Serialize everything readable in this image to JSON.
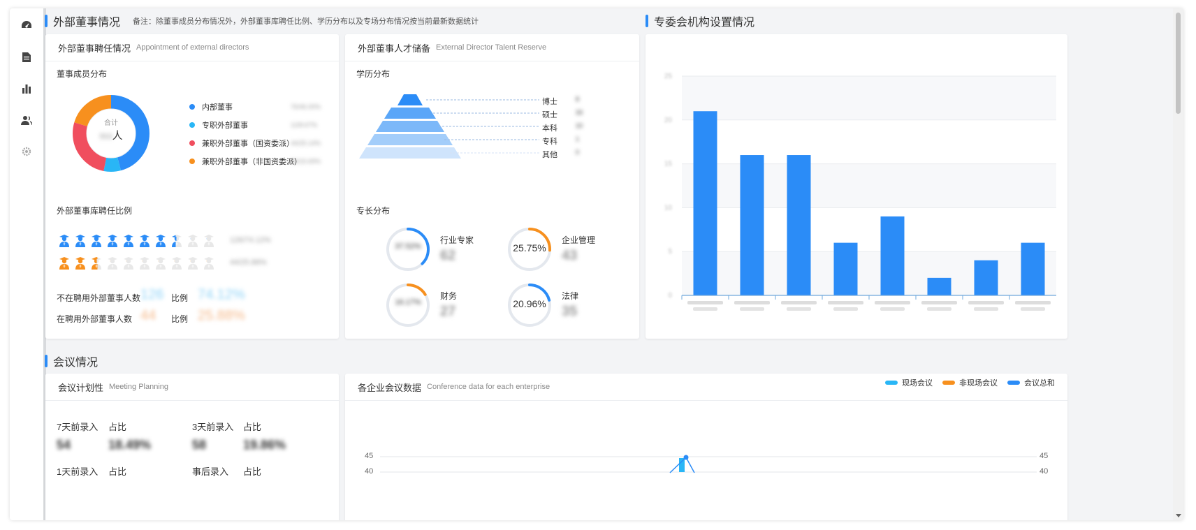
{
  "sidebar": {
    "icons": [
      "dashboard-icon",
      "document-icon",
      "bar-chart-icon",
      "users-icon",
      "gear-icon"
    ]
  },
  "sections": {
    "external_directors": {
      "title": "外部董事情况",
      "note": "备注：除董事成员分布情况外，外部董事库聘任比例、学历分布以及专场分布情况按当前最新数据统计"
    },
    "committee": {
      "title": "专委会机构设置情况"
    },
    "meetings": {
      "title": "会议情况"
    }
  },
  "appointment_card": {
    "title": "外部董事聘任情况",
    "title_en": "Appointment of external directors",
    "member_dist_label": "董事成员分布",
    "donut": {
      "center_label": "合计",
      "center_value": "553",
      "center_unit": "人"
    },
    "legend": [
      {
        "label": "内部董事",
        "value": "76/46.00%",
        "color": "#2b8cf7"
      },
      {
        "label": "专职外部董事",
        "value": "12/8.67%",
        "color": "#29b6f6"
      },
      {
        "label": "兼职外部董事（国资委派）",
        "value": "44/25.14%",
        "color": "#f04e5e"
      },
      {
        "label": "兼职外部董事（非国资委派）",
        "value": "34/15.69%",
        "color": "#f7901e"
      }
    ],
    "ratio_label": "外部董事库聘任比例",
    "people_rows": [
      {
        "value": "126/74.12%",
        "fill": 0.74,
        "color": "#2b8cf7"
      },
      {
        "value": "44/25.88%",
        "fill": 0.26,
        "color": "#f7901e"
      }
    ],
    "stats": [
      {
        "label": "不在聘用外部董事人数",
        "num": "126",
        "ratio_label": "比例",
        "pct": "74.12%",
        "color": "#8fd3f7"
      },
      {
        "label": "在聘用外部董事人数",
        "num": "44",
        "ratio_label": "比例",
        "pct": "25.88%",
        "color": "#f5b98a"
      }
    ]
  },
  "talent_card": {
    "title": "外部董事人才储备",
    "title_en": "External Director Talent Reserve",
    "edu_label": "学历分布",
    "edu": [
      {
        "label": "博士",
        "value": "8"
      },
      {
        "label": "硕士",
        "value": "33"
      },
      {
        "label": "本科",
        "value": "10"
      },
      {
        "label": "专科",
        "value": "1"
      },
      {
        "label": "其他",
        "value": "0"
      }
    ],
    "spec_label": "专长分布",
    "specialties": [
      {
        "name": "行业专家",
        "value": "62",
        "pct_text": "37.52%",
        "fraction": 0.3752,
        "color": "#2b8cf7",
        "blurred": true
      },
      {
        "name": "企业管理",
        "value": "43",
        "pct_text": "25.75%",
        "fraction": 0.2575,
        "color": "#f7901e",
        "blurred": false
      },
      {
        "name": "财务",
        "value": "27",
        "pct_text": "16.17%",
        "fraction": 0.1617,
        "color": "#f7901e",
        "blurred": true
      },
      {
        "name": "法律",
        "value": "35",
        "pct_text": "20.96%",
        "fraction": 0.2096,
        "color": "#2b8cf7",
        "blurred": false
      }
    ]
  },
  "chart_data": [
    {
      "type": "bar",
      "categories": [
        "",
        "",
        "",
        "",
        "",
        "",
        "",
        ""
      ],
      "values": [
        21,
        16,
        16,
        6,
        9,
        2,
        4,
        6
      ],
      "ylim": [
        0,
        25
      ],
      "yticks": [
        "0",
        "5",
        "10",
        "15",
        "20",
        "25"
      ],
      "color": "#2b8cf7",
      "grid": true
    },
    {
      "type": "line",
      "ylim": [
        40,
        45
      ],
      "yticks": [
        "40",
        "45"
      ],
      "legend": [
        {
          "name": "现场会议",
          "color": "#29b6f6"
        },
        {
          "name": "非现场会议",
          "color": "#f7901e"
        },
        {
          "name": "会议总和",
          "color": "#2b8cf7"
        }
      ],
      "legend_position": "top-right"
    }
  ],
  "planning_card": {
    "title": "会议计划性",
    "title_en": "Meeting Planning",
    "items": [
      {
        "label": "7天前录入",
        "ratio_label": "占比",
        "num": "54",
        "pct": "18.49%"
      },
      {
        "label": "3天前录入",
        "ratio_label": "占比",
        "num": "58",
        "pct": "19.86%"
      },
      {
        "label": "1天前录入",
        "ratio_label": "占比"
      },
      {
        "label": "事后录入",
        "ratio_label": "占比"
      }
    ]
  },
  "enterprise_card": {
    "title": "各企业会议数据",
    "title_en": "Conference data for each enterprise"
  }
}
